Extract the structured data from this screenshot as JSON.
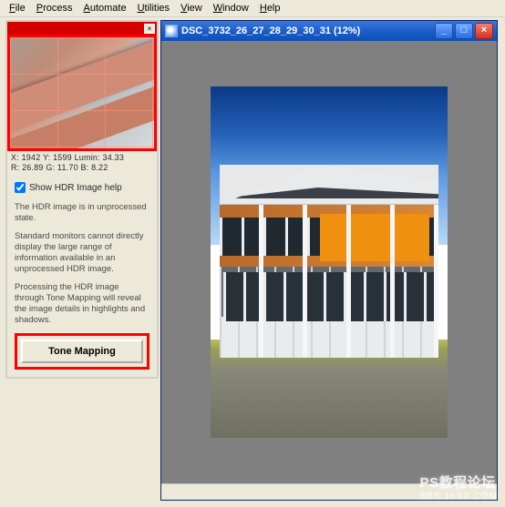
{
  "menubar": {
    "file": "File",
    "process": "Process",
    "automate": "Automate",
    "utilities": "Utilities",
    "view": "View",
    "window": "Window",
    "help": "Help"
  },
  "preview_panel": {
    "readout_line1": "X:   1942   Y:   1599   Lumin:      34.33",
    "readout_line2": "R:    26.89   G:    11.70   B:          8.22",
    "checkbox_label": "Show HDR Image help",
    "help_p1": "The HDR image is in unprocessed state.",
    "help_p2": "Standard monitors cannot directly display the large range of information available in an unprocessed HDR image.",
    "help_p3": "Processing the HDR image through Tone Mapping will reveal the image details in highlights and shadows.",
    "button_label": "Tone Mapping"
  },
  "image_window": {
    "title": "DSC_3732_26_27_28_29_30_31 (12%)",
    "min_glyph": "_",
    "max_glyph": "□",
    "close_glyph": "×"
  },
  "watermark": {
    "line1": "PS教程论坛",
    "line2": "BBS.16XX.COM"
  }
}
